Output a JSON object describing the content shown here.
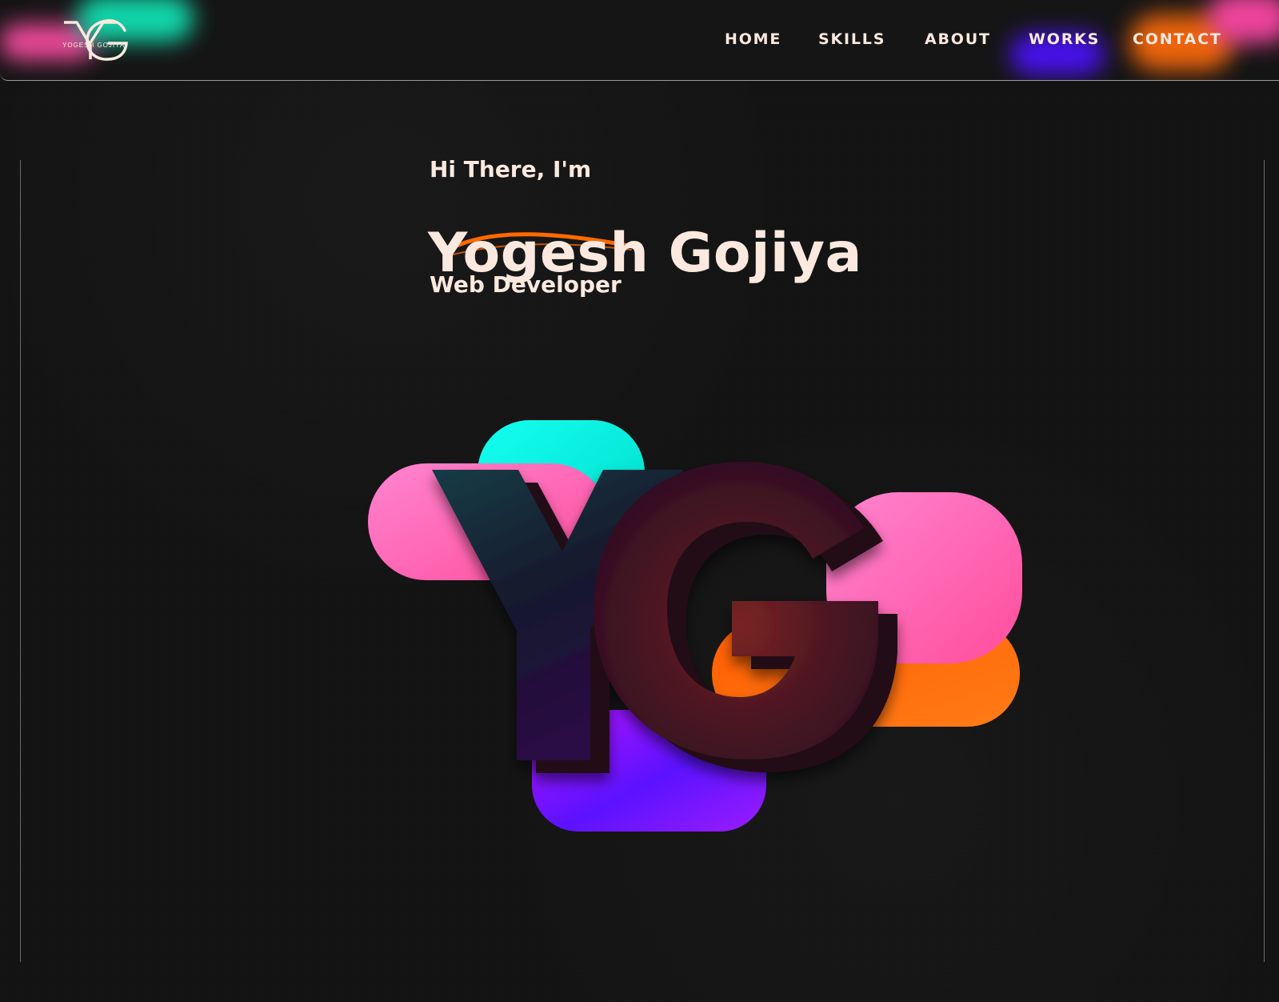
{
  "logo": {
    "monogram": "YG",
    "wordmark": "YOGESH GOJIYA"
  },
  "nav": {
    "items": [
      {
        "label": "HOME"
      },
      {
        "label": "SKILLS"
      },
      {
        "label": "ABOUT"
      },
      {
        "label": "WORKS"
      },
      {
        "label": "CONTACT"
      }
    ]
  },
  "hero": {
    "greeting": "Hi There, I'm",
    "name": "Yogesh Gojiya",
    "role": "Web Developer"
  },
  "emblem": {
    "letters": "YG"
  },
  "colors": {
    "background": "#131313",
    "text": "#fbe9df",
    "teal": "#00f3df",
    "pink": "#ff5db8",
    "orange": "#ff6a00",
    "purple": "#5b14ff",
    "dark_logo": "#2d0d1d"
  }
}
